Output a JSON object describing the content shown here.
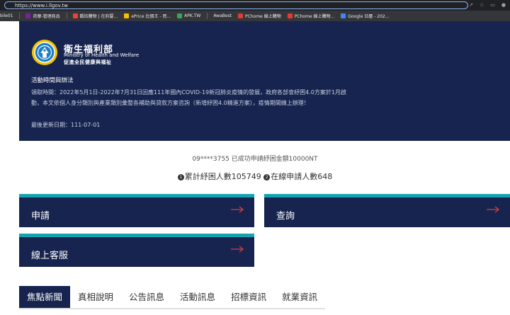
{
  "browser": {
    "url": "https://www.i.llgov.tw",
    "bookmarks": [
      {
        "label": "bile01",
        "color": "#f29900"
      },
      {
        "label": "奇摩-管理商品",
        "color": "#7b1fa2"
      },
      {
        "label": "觀炫購物 | 在府要...",
        "color": "#ea4335"
      },
      {
        "label": "ePrice 比價王 - 買...",
        "color": "#fbbc04"
      },
      {
        "label": "APK.TW",
        "color": "#34a853"
      },
      {
        "label": "AwaBest",
        "color": "#5f6368"
      },
      {
        "label": "PChome 線上購物",
        "color": "#e53935"
      },
      {
        "label": "PChome 線上購物...",
        "color": "#e53935"
      },
      {
        "label": "Google 日曆 - 202...",
        "color": "#4285f4"
      }
    ]
  },
  "hero": {
    "brand_zh": "衛生福利部",
    "brand_en": "Ministry of Health and Welfare",
    "brand_slogan": "促進全民健康與福祉",
    "info_title": "活動時間與辦法",
    "info_body": "領取時間：2022年5月1日-2022年7月31日因應111年國內COVID-19新冠肺炎疫情的發展，政府各部會紓困4.0方案於1月啟動，本文依個人身分類別與產業類別彙整各補助與貸款方案咨詢（新增紓困4.0精進方案），疫情期間線上辦理！",
    "info_update": "最後更新日期：111-07-01"
  },
  "ticker": "09****3755 已成功申請紓困金額10000NT",
  "stats": {
    "badge1": "1",
    "label1": "累計紓困人數105749",
    "badge2": "2",
    "label2": "在線申請人數648"
  },
  "cards": {
    "apply": "申請",
    "query": "查詢",
    "support": "線上客服"
  },
  "tabs": [
    "焦點新聞",
    "真相說明",
    "公告訊息",
    "活動訊息",
    "招標資訊",
    "就業資訊"
  ],
  "colors": {
    "navy": "#16244f",
    "teal": "#16a3ad",
    "arrow": "#e53935"
  }
}
